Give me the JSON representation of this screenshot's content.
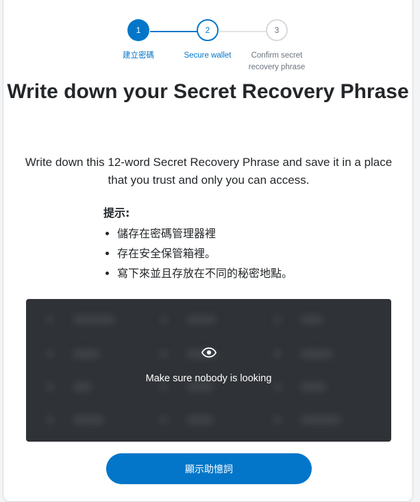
{
  "stepper": {
    "steps": [
      {
        "number": "1",
        "label": "建立密碼",
        "state": "done"
      },
      {
        "number": "2",
        "label": "Secure wallet",
        "state": "active"
      },
      {
        "number": "3",
        "label": "Confirm secret recovery phrase",
        "state": "todo"
      }
    ]
  },
  "title": "Write down your Secret Recovery Phrase",
  "description": "Write down this 12-word Secret Recovery Phrase and save it in a place that you trust and only you can access.",
  "tips": {
    "title": "提示:",
    "items": [
      "儲存在密碼管理器裡",
      "存在安全保管箱裡。",
      "寫下來並且存放在不同的秘密地點。"
    ]
  },
  "srp": {
    "hint": "Make sure nobody is looking",
    "icon": "eye-icon"
  },
  "reveal_button": {
    "label": "顯示助憶詞"
  },
  "colors": {
    "primary": "#0376c9",
    "srp_background": "#2f3236",
    "text": "#24272a"
  }
}
